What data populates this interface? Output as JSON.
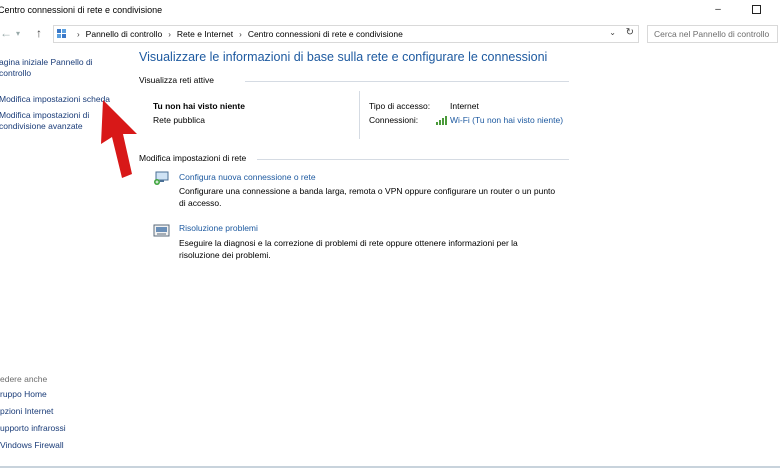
{
  "window": {
    "title": "Centro connessioni di rete e condivisione",
    "minimize_icon": "minimize-icon",
    "maximize_icon": "maximize-icon"
  },
  "address_bar": {
    "back_icon": "back-arrow-icon",
    "forward_icon": "forward-arrow-icon",
    "up_icon": "up-arrow-icon",
    "breadcrumbs": [
      "Pannello di controllo",
      "Rete e Internet",
      "Centro connessioni di rete e condivisione"
    ],
    "refresh_icon": "refresh-icon"
  },
  "search": {
    "placeholder": "Cerca nel Pannello di controllo"
  },
  "sidebar": {
    "links": [
      "agina iniziale Pannello di controllo",
      "Modifica impostazioni scheda",
      "Modifica impostazioni di condivisione avanzate"
    ],
    "see_also_header": "edere anche",
    "see_also": [
      "ruppo Home",
      "pzioni Internet",
      "upporto infrarossi",
      "Vindows Firewall"
    ]
  },
  "main": {
    "heading": "Visualizzare le informazioni di base sulla rete e configurare le connessioni",
    "active_header": "Visualizza reti attive",
    "network": {
      "name": "Tu non hai visto niente",
      "type": "Rete pubblica",
      "access_label": "Tipo di accesso:",
      "access_value": "Internet",
      "connections_label": "Connessioni:",
      "connection_value": "Wi-Fi (Tu non hai visto niente)"
    },
    "change_header": "Modifica impostazioni di rete",
    "tasks": [
      {
        "link": "Configura nuova connessione o rete",
        "desc": "Configurare una connessione a banda larga, remota o VPN oppure configurare un router o un punto di accesso."
      },
      {
        "link": "Risoluzione problemi",
        "desc": "Eseguire la diagnosi e la correzione di problemi di rete oppure ottenere informazioni per la risoluzione dei problemi."
      }
    ]
  },
  "colors": {
    "link": "#1e5aa0",
    "heading": "#1e5aa0",
    "annotation_arrow": "#d81818"
  }
}
